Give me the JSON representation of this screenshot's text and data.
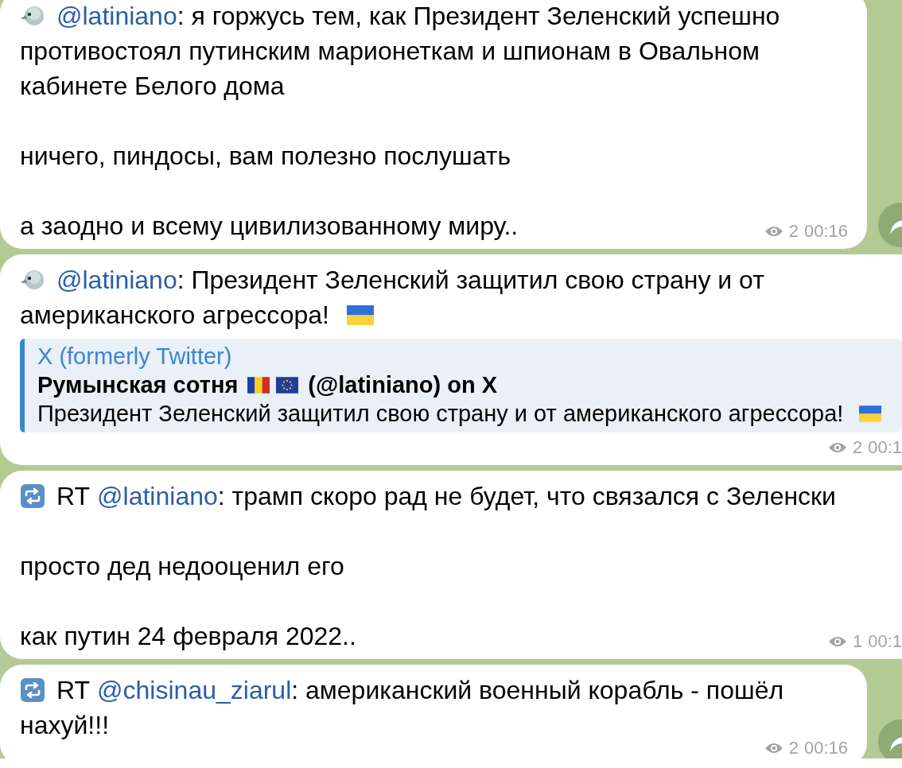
{
  "messages": [
    {
      "kind": "bird",
      "handle": "@latiniano",
      "paragraphs": [
        {
          "text": ": я горжусь тем, как Президент Зеленский успешно противостоял путинским марионеткам и шпионам в Овальном кабинете Белого дома"
        },
        {
          "text": "ничего, пиндосы, вам полезно послушать"
        },
        {
          "text": "а заодно и всему цивилизованному миру.."
        }
      ],
      "views": "2",
      "time": "00:16",
      "share": true
    },
    {
      "kind": "bird",
      "handle": "@latiniano",
      "paragraphs": [
        {
          "text": ": Президент Зеленский защитил свою страну и от американского агрессора!",
          "kind": "flag-ua"
        }
      ],
      "preview": {
        "site": "X (formerly Twitter)",
        "title": "Румынская сотня",
        "title_icons": [
          {
            "kind": "flag-ro"
          },
          {
            "kind": "flag-eu"
          }
        ],
        "title_rest": "(@latiniano) on X",
        "description": "Президент Зеленский защитил свою страну и от американского агрессора!",
        "kind": "flag-ua"
      },
      "views": "2",
      "time": "00:1",
      "share": false
    },
    {
      "kind": "retweet",
      "prefix": "RT",
      "handle": "@latiniano",
      "paragraphs": [
        {
          "text": ": трамп скоро рад не будет, что связался с Зеленски"
        },
        {
          "text": "просто дед недооценил его"
        },
        {
          "text": "как путин 24 февраля 2022.."
        }
      ],
      "views": "1",
      "time": "00:1",
      "share": false
    },
    {
      "kind": "retweet",
      "prefix": "RT",
      "handle": "@chisinau_ziarul",
      "paragraphs": [
        {
          "text": ": американский военный корабль - пошёл нахуй!!!"
        }
      ],
      "views": "2",
      "time": "00:16",
      "share": true
    }
  ]
}
